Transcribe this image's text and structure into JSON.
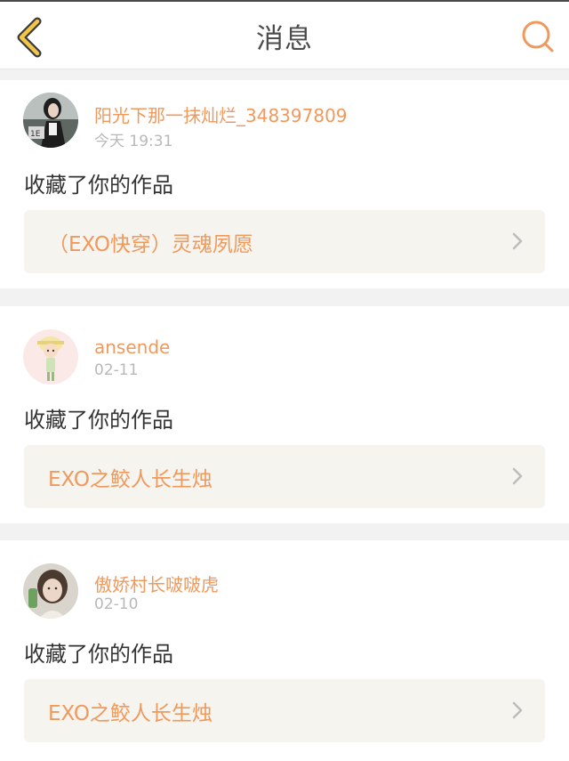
{
  "header": {
    "title": "消息",
    "back_icon": "chevron-left-icon",
    "search_icon": "search-icon",
    "accent_color": "#f0995d"
  },
  "messages": [
    {
      "username": "阳光下那一抹灿烂_348397809",
      "time": "今天 19:31",
      "action": "收藏了你的作品",
      "work_title": "（EXO快穿）灵魂夙愿"
    },
    {
      "username": "ansende",
      "time": "02-11",
      "action": "收藏了你的作品",
      "work_title": "EXO之鲛人长生烛"
    },
    {
      "username": "傲娇村长啵啵虎",
      "time": "02-10",
      "action": "收藏了你的作品",
      "work_title": "EXO之鲛人长生烛"
    }
  ]
}
